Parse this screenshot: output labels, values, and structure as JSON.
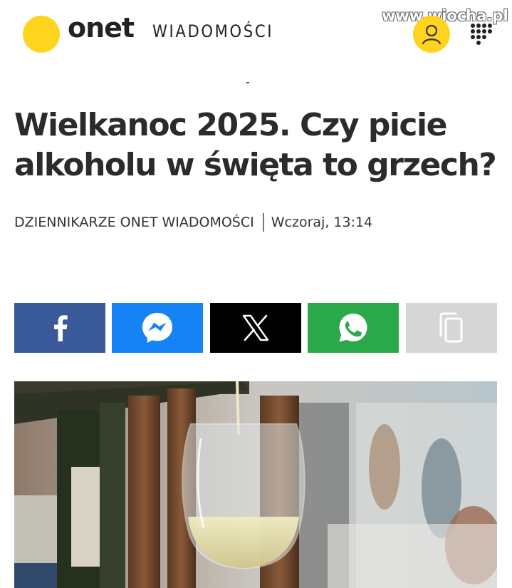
{
  "header": {
    "brand": "onet",
    "section": "WIADOMOŚCI",
    "watermark": "www.wiocha.pl",
    "icons": {
      "logo": "onet-logo-dot",
      "account": "user-icon",
      "menu": "grid-menu-icon"
    }
  },
  "article": {
    "title": "Wielkanoc 2025. Czy picie alkoholu w święta to grzech?",
    "author": "DZIENNIKARZE ONET WIADOMOŚCI",
    "timestamp": "Wczoraj, 13:14"
  },
  "share": [
    {
      "service": "facebook",
      "icon": "facebook-icon",
      "color": "#3A5998"
    },
    {
      "service": "messenger",
      "icon": "messenger-icon",
      "color": "#1683F4"
    },
    {
      "service": "x",
      "icon": "x-icon",
      "color": "#000000"
    },
    {
      "service": "whatsapp",
      "icon": "whatsapp-icon",
      "color": "#2BA94A"
    },
    {
      "service": "copy-link",
      "icon": "copy-icon",
      "color": "#D6D6D6"
    }
  ],
  "image": {
    "subject": "wine-glass-photo"
  },
  "colors": {
    "brand_yellow": "#FFD41F",
    "text": "#2b2b2b"
  }
}
